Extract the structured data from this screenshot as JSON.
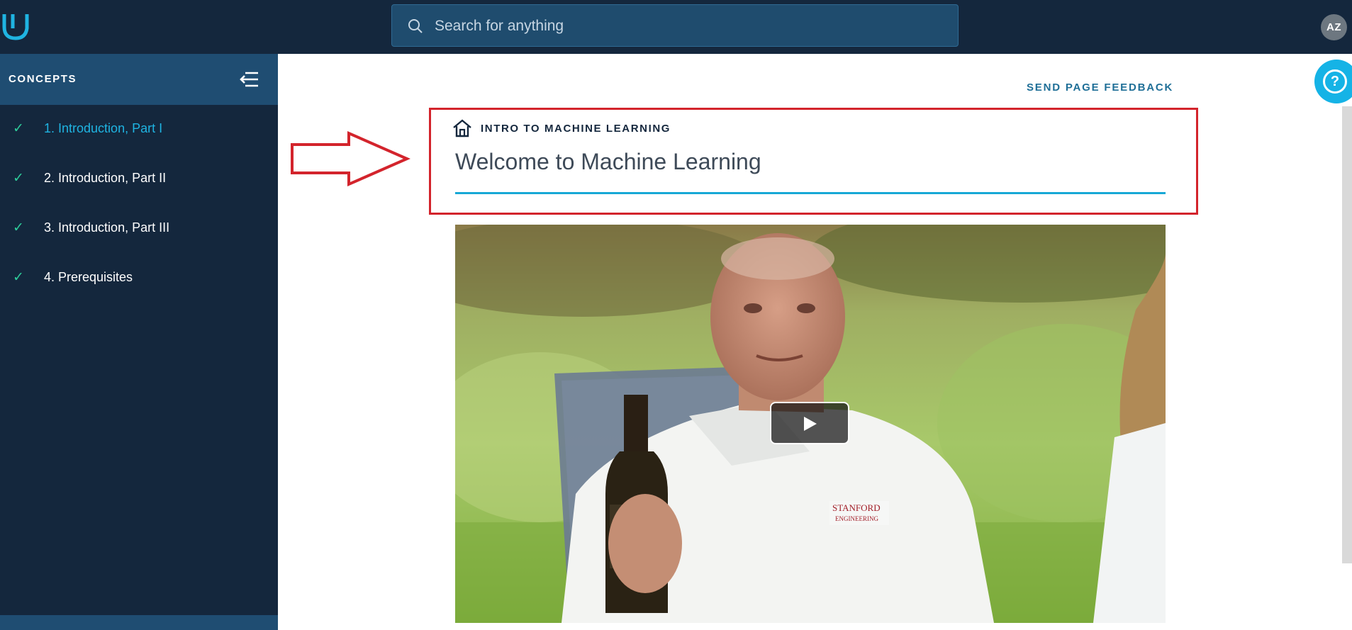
{
  "topbar": {
    "logo_icon": "udacity-logo-icon",
    "search": {
      "placeholder": "Search for anything",
      "icon": "search-icon"
    },
    "avatar_initials": "AZ"
  },
  "sidebar": {
    "title": "CONCEPTS",
    "collapse_icon": "collapse-menu-icon",
    "items": [
      {
        "label": "1. Introduction, Part I",
        "completed": true,
        "active": true
      },
      {
        "label": "2. Introduction, Part II",
        "completed": true,
        "active": false
      },
      {
        "label": "3. Introduction, Part III",
        "completed": true,
        "active": false
      },
      {
        "label": "4. Prerequisites",
        "completed": true,
        "active": false
      }
    ]
  },
  "main": {
    "feedback_link": "SEND PAGE FEEDBACK",
    "lesson_icon": "home-icon",
    "lesson_name": "INTRO TO MACHINE LEARNING",
    "concept_title": "Welcome to Machine Learning",
    "video": {
      "play_icon": "play-icon",
      "shirt_logo": "STANFORD ENGINEERING"
    }
  },
  "annotations": {
    "highlight_color": "#d3242c",
    "arrow_icon": "right-arrow-icon"
  },
  "help_button": {
    "icon": "help-icon",
    "symbol": "?"
  },
  "colors": {
    "navy": "#14273d",
    "accent": "#17a8d6",
    "check": "#2ecc9a"
  }
}
